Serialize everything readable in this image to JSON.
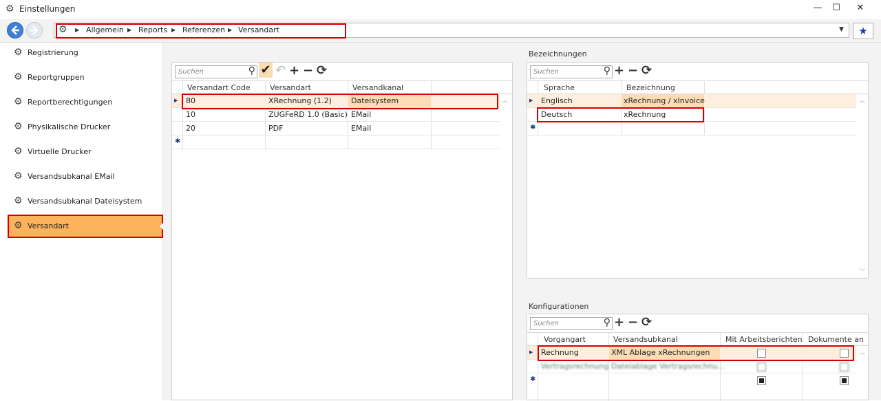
{
  "window": {
    "title": "Einstellungen"
  },
  "window_controls": {
    "minimize": "—",
    "maximize": "☐",
    "close": "✕"
  },
  "breadcrumb": [
    "Allgemein",
    "Reports",
    "Referenzen",
    "Versandart"
  ],
  "sidebar": {
    "items": [
      {
        "label": "Registrierung"
      },
      {
        "label": "Reportgruppen"
      },
      {
        "label": "Reportberechtigungen"
      },
      {
        "label": "Physikalische Drucker"
      },
      {
        "label": "Virtuelle Drucker"
      },
      {
        "label": "Versandsubkanal EMail"
      },
      {
        "label": "Versandsubkanal Dateisystem"
      },
      {
        "label": "Versandart"
      }
    ],
    "selected": "Versandart"
  },
  "versandart_grid": {
    "search_placeholder": "Suchen",
    "columns": [
      "Versandart Code",
      "Versandart",
      "Versandkanal"
    ],
    "rows": [
      {
        "code": "80",
        "versandart": "XRechnung (1.2)",
        "kanal": "Dateisystem"
      },
      {
        "code": "10",
        "versandart": "ZUGFeRD 1.0 (Basic)",
        "kanal": "EMail"
      },
      {
        "code": "20",
        "versandart": "PDF",
        "kanal": "EMail"
      }
    ]
  },
  "bezeichnungen": {
    "title": "Bezeichnungen",
    "search_placeholder": "Suchen",
    "columns": [
      "Sprache",
      "Bezeichnung"
    ],
    "rows": [
      {
        "sprache": "Englisch",
        "bezeichnung": "xRechnung / xInvoice"
      },
      {
        "sprache": "Deutsch",
        "bezeichnung": "xRechnung"
      }
    ]
  },
  "konfigurationen": {
    "title": "Konfigurationen",
    "search_placeholder": "Suchen",
    "columns": [
      "Vorgangart",
      "Versandsubkanal",
      "Mit Arbeitsberichten",
      "Dokumente an"
    ],
    "rows": [
      {
        "vorgangart": "Rechnung",
        "subkanal": "XML Ablage xRechnungen",
        "mit_ab": false,
        "dok": false
      },
      {
        "vorgangart": "Vertragsrechnung",
        "subkanal": "Dateiablage Vertragsrechnu...",
        "mit_ab": false,
        "dok": false
      }
    ],
    "new_row": {
      "mit_ab": true,
      "dok": true
    }
  },
  "colors": {
    "selected": "#fdb35b",
    "row_highlight": "#fdeedd",
    "cell_highlight": "#fbdcb5",
    "annotation": "#d40000"
  }
}
